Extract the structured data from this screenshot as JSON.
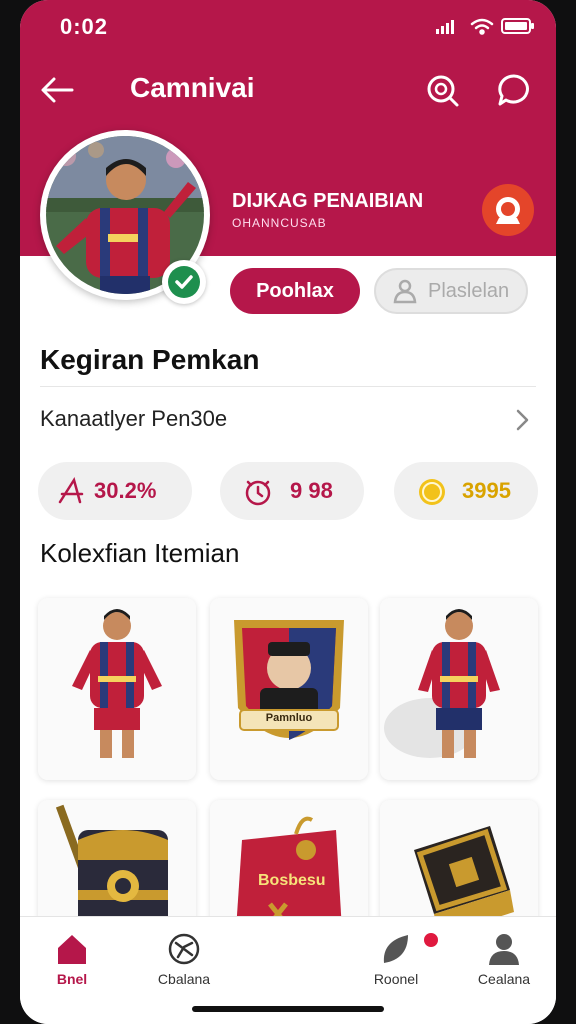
{
  "status_bar": {
    "time": "0:02"
  },
  "header": {
    "title": "Camnivai"
  },
  "profile": {
    "name": "DIJKAG PENAIBIAN",
    "subtitle": "OHANNCUSAB",
    "primary_button": "Poohlax",
    "secondary_button": "Plaslelan"
  },
  "activity": {
    "title": "Kegiran Pemkan",
    "row_label": "Kanaatlyer Pen30e",
    "stats": [
      {
        "icon": "percent-icon",
        "value": "30.2%",
        "color": "#b5174a"
      },
      {
        "icon": "timer-icon",
        "value": "9 98",
        "color": "#b5174a"
      },
      {
        "icon": "coin-icon",
        "value": "3995",
        "color": "#d9a300"
      }
    ]
  },
  "collection": {
    "title": "Kolexfian Itemian",
    "items": [
      {
        "name": "player-card-1",
        "caption": ""
      },
      {
        "name": "crest-card",
        "caption": "Pamnluo"
      },
      {
        "name": "player-card-2",
        "caption": ""
      },
      {
        "name": "treasure-chest-card",
        "caption": ""
      },
      {
        "name": "pouch-card",
        "caption": "Bosbesu"
      },
      {
        "name": "box-card",
        "caption": ""
      }
    ]
  },
  "bottom_nav": {
    "items": [
      {
        "label": "Bnel",
        "icon": "home-icon",
        "active": true
      },
      {
        "label": "Cbalana",
        "icon": "ball-icon",
        "active": false
      },
      {
        "label": "Roonel",
        "icon": "leaf-icon",
        "active": false
      },
      {
        "label": "Cealana",
        "icon": "user-icon",
        "active": false
      }
    ]
  },
  "colors": {
    "brand": "#b5174a",
    "accent": "#e4452a",
    "gold": "#d9a300",
    "verified": "#1e8f4e"
  }
}
